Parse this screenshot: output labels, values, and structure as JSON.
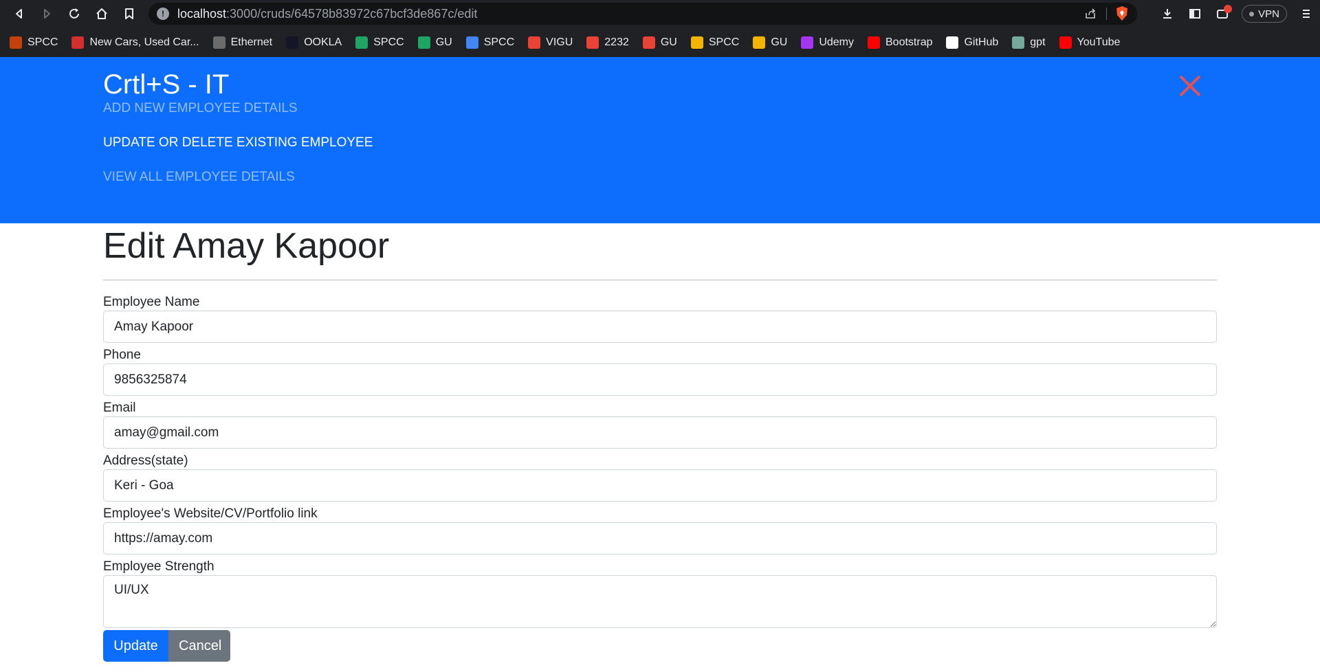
{
  "browser": {
    "url_host": "localhost",
    "url_rest": ":3000/cruds/64578b83972c67bcf3de867c/edit",
    "vpn_label": "VPN",
    "bookmarks": [
      {
        "label": "SPCC",
        "icon": "spcc-logo-icon",
        "color": "#c2410c"
      },
      {
        "label": "New Cars, Used Car...",
        "icon": "cars-icon",
        "color": "#d32f2f"
      },
      {
        "label": "Ethernet",
        "icon": "ethernet-icon",
        "color": "#6b6b6b"
      },
      {
        "label": "OOKLA",
        "icon": "ookla-icon",
        "color": "#141526"
      },
      {
        "label": "SPCC",
        "icon": "drive-icon",
        "color": "#1fa463"
      },
      {
        "label": "GU",
        "icon": "drive-icon",
        "color": "#1fa463"
      },
      {
        "label": "SPCC",
        "icon": "google-icon",
        "color": "#4285f4"
      },
      {
        "label": "VIGU",
        "icon": "gmail-icon",
        "color": "#ea4335"
      },
      {
        "label": "2232",
        "icon": "gmail-icon",
        "color": "#ea4335"
      },
      {
        "label": "GU",
        "icon": "gmail-icon",
        "color": "#ea4335"
      },
      {
        "label": "SPCC",
        "icon": "classroom-icon",
        "color": "#f4b400"
      },
      {
        "label": "GU",
        "icon": "classroom-icon",
        "color": "#f4b400"
      },
      {
        "label": "Udemy",
        "icon": "udemy-icon",
        "color": "#a435f0"
      },
      {
        "label": "Bootstrap",
        "icon": "youtube-icon",
        "color": "#ff0000"
      },
      {
        "label": "GitHub",
        "icon": "github-icon",
        "color": "#ffffff"
      },
      {
        "label": "gpt",
        "icon": "openai-icon",
        "color": "#74aa9c"
      },
      {
        "label": "YouTube",
        "icon": "youtube-icon",
        "color": "#ff0000"
      }
    ]
  },
  "navbar": {
    "brand": "Crtl+S - IT",
    "links": [
      {
        "label": "Add New Employee Details",
        "active": false
      },
      {
        "label": "Update or Delete Existing Employee",
        "active": true
      },
      {
        "label": "View All Employee Details",
        "active": false
      }
    ]
  },
  "page": {
    "title": "Edit Amay Kapoor",
    "fields": {
      "name": {
        "label": "Employee Name",
        "value": "Amay Kapoor"
      },
      "phone": {
        "label": "Phone",
        "value": "9856325874"
      },
      "email": {
        "label": "Email",
        "value": "amay@gmail.com"
      },
      "address": {
        "label": "Address(state)",
        "value": "Keri - Goa"
      },
      "website": {
        "label": "Employee's Website/CV/Portfolio link",
        "value": "https://amay.com"
      },
      "strength": {
        "label": "Employee Strength",
        "value": "UI/UX"
      }
    },
    "buttons": {
      "update": "Update",
      "cancel": "Cancel"
    }
  },
  "colors": {
    "primary": "#0d6efd",
    "secondary": "#6c757d",
    "close": "#e4534f"
  }
}
